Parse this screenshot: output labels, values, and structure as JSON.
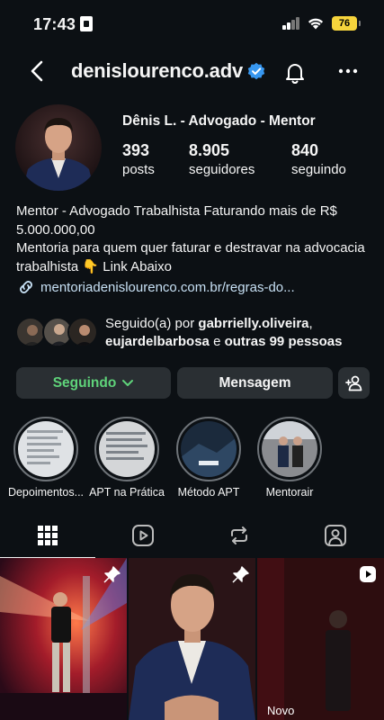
{
  "status_bar": {
    "time": "17:43",
    "battery": "76"
  },
  "header": {
    "username": "denislourenco.adv"
  },
  "profile": {
    "full_name": "Dênis L. - Advogado - Mentor",
    "stats": [
      {
        "value": "393",
        "label": "posts"
      },
      {
        "value": "8.905",
        "label": "seguidores"
      },
      {
        "value": "840",
        "label": "seguindo"
      }
    ],
    "bio_line1": "Mentor - Advogado Trabalhista Faturando mais de R$ 5.000.000,00",
    "bio_line2": "Mentoria para quem quer faturar e destravar na advocacia trabalhista",
    "bio_emoji": "👇",
    "bio_link_label": "Link Abaixo",
    "link": "mentoriadenislourenco.com.br/regras-do..."
  },
  "followed_by": {
    "prefix": "Seguido(a) por",
    "user1": "gabrrielly.oliveira",
    "user2": "eujardelbarbosa",
    "connector": "e",
    "others": "outras 99 pessoas"
  },
  "actions": {
    "following": "Seguindo",
    "message": "Mensagem"
  },
  "highlights": [
    {
      "label": "Depoimentos..."
    },
    {
      "label": "APT na Prática"
    },
    {
      "label": "Método APT"
    },
    {
      "label": "Mentorair"
    }
  ],
  "grid": {
    "new_label": "Novo"
  },
  "colors": {
    "background": "#0c1014",
    "button": "#2a2f33",
    "following_green": "#5fd37a",
    "verified_blue": "#3797f0",
    "battery": "#f6d43c"
  }
}
